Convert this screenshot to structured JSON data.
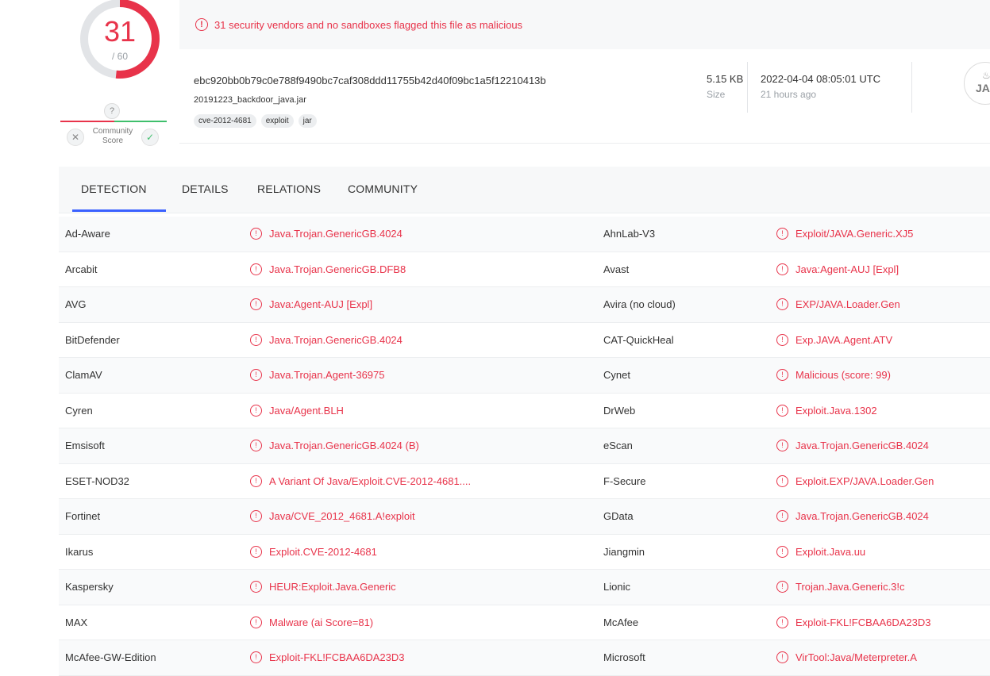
{
  "score": {
    "detected": "31",
    "total": "/ 60",
    "fraction": 0.5167
  },
  "community": {
    "question": "?",
    "label": "Community Score",
    "reject": "✕",
    "accept": "✓"
  },
  "banner": {
    "icon": "alert-icon",
    "text": "31 security vendors and no sandboxes flagged this file as malicious"
  },
  "file": {
    "hash": "ebc920bb0b79c0e788f9490bc7caf308ddd11755b42d40f09bc1a5f12210413b",
    "name": "20191223_backdoor_java.jar",
    "tags": [
      "cve-2012-4681",
      "exploit",
      "jar"
    ],
    "size_value": "5.15 KB",
    "size_label": "Size",
    "date_value": "2022-04-04 08:05:01 UTC",
    "date_relative": "21 hours ago",
    "type_icon_text": "JA"
  },
  "tabs": [
    "DETECTION",
    "DETAILS",
    "RELATIONS",
    "COMMUNITY"
  ],
  "detections": [
    [
      "Ad-Aware",
      "Java.Trojan.GenericGB.4024",
      "AhnLab-V3",
      "Exploit/JAVA.Generic.XJ5"
    ],
    [
      "Arcabit",
      "Java.Trojan.GenericGB.DFB8",
      "Avast",
      "Java:Agent-AUJ [Expl]"
    ],
    [
      "AVG",
      "Java:Agent-AUJ [Expl]",
      "Avira (no cloud)",
      "EXP/JAVA.Loader.Gen"
    ],
    [
      "BitDefender",
      "Java.Trojan.GenericGB.4024",
      "CAT-QuickHeal",
      "Exp.JAVA.Agent.ATV"
    ],
    [
      "ClamAV",
      "Java.Trojan.Agent-36975",
      "Cynet",
      "Malicious (score: 99)"
    ],
    [
      "Cyren",
      "Java/Agent.BLH",
      "DrWeb",
      "Exploit.Java.1302"
    ],
    [
      "Emsisoft",
      "Java.Trojan.GenericGB.4024 (B)",
      "eScan",
      "Java.Trojan.GenericGB.4024"
    ],
    [
      "ESET-NOD32",
      "A Variant Of Java/Exploit.CVE-2012-4681....",
      "F-Secure",
      "Exploit.EXP/JAVA.Loader.Gen"
    ],
    [
      "Fortinet",
      "Java/CVE_2012_4681.A!exploit",
      "GData",
      "Java.Trojan.GenericGB.4024"
    ],
    [
      "Ikarus",
      "Exploit.CVE-2012-4681",
      "Jiangmin",
      "Exploit.Java.uu"
    ],
    [
      "Kaspersky",
      "HEUR:Exploit.Java.Generic",
      "Lionic",
      "Trojan.Java.Generic.3!c"
    ],
    [
      "MAX",
      "Malware (ai Score=81)",
      "McAfee",
      "Exploit-FKL!FCBAA6DA23D3"
    ],
    [
      "McAfee-GW-Edition",
      "Exploit-FKL!FCBAA6DA23D3",
      "Microsoft",
      "VirTool:Java/Meterpreter.A"
    ]
  ],
  "colors": {
    "malicious": "#e8334a",
    "tab_indicator": "#3b61ff",
    "harmless": "#3fbf6c"
  }
}
